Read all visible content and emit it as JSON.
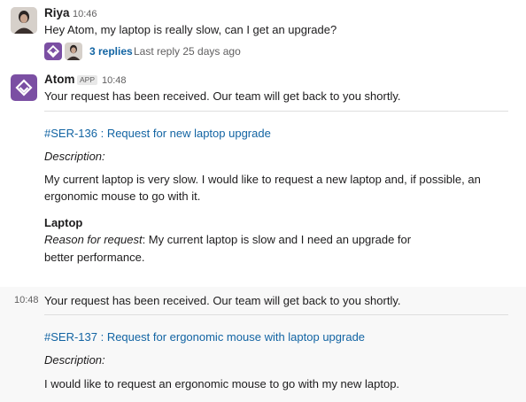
{
  "messages": {
    "riya": {
      "name": "Riya",
      "time": "10:46",
      "text": "Hey Atom, my laptop is really slow, can I get an upgrade?",
      "thread": {
        "replies": "3 replies",
        "last_reply": "Last reply 25 days ago"
      }
    },
    "atom": {
      "name": "Atom",
      "badge": "APP",
      "time": "10:48",
      "text": "Your request has been received. Our team will get back to you shortly.",
      "ticket": {
        "link": "#SER-136 : Request for new laptop upgrade",
        "desc_label": "Description:",
        "desc_line1": "My current laptop is very slow. I would like to request a new laptop and, if possible, an",
        "desc_line2": "ergonomic mouse to go with it.",
        "item_title": "Laptop",
        "reason_label": "Reason for request",
        "reason_line1": ": My current laptop is slow and I need an upgrade for",
        "reason_line2": "better performance."
      }
    },
    "atom2": {
      "time": "10:48",
      "text": "Your request has been received. Our team will get back to you shortly.",
      "ticket": {
        "link": "#SER-137 : Request for ergonomic mouse with laptop upgrade",
        "desc_label": "Description:",
        "desc_line1": "I would like to request an ergonomic mouse to go with my new laptop."
      }
    }
  },
  "colors": {
    "link": "#1264a3",
    "app_avatar": "#7b4fa3",
    "text": "#1d1c1d",
    "muted": "#616061"
  },
  "icons": {
    "app_logo": "atom-logo-icon",
    "user_avatar": "riya-avatar"
  }
}
